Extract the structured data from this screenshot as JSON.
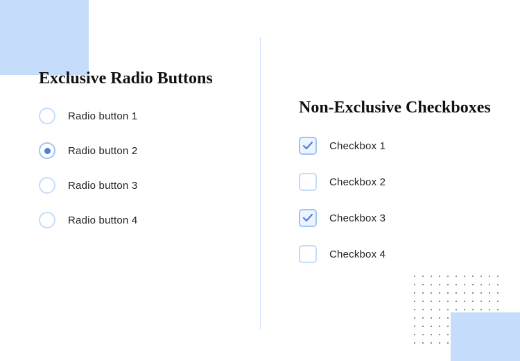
{
  "radio": {
    "heading": "Exclusive Radio Buttons",
    "items": [
      {
        "label": "Radio button 1",
        "selected": false
      },
      {
        "label": "Radio button 2",
        "selected": true
      },
      {
        "label": "Radio button 3",
        "selected": false
      },
      {
        "label": "Radio button 4",
        "selected": false
      }
    ]
  },
  "checkbox": {
    "heading": "Non-Exclusive Checkboxes",
    "items": [
      {
        "label": "Checkbox 1",
        "checked": true
      },
      {
        "label": "Checkbox 2",
        "checked": false
      },
      {
        "label": "Checkbox 3",
        "checked": true
      },
      {
        "label": "Checkbox 4",
        "checked": false
      }
    ]
  }
}
